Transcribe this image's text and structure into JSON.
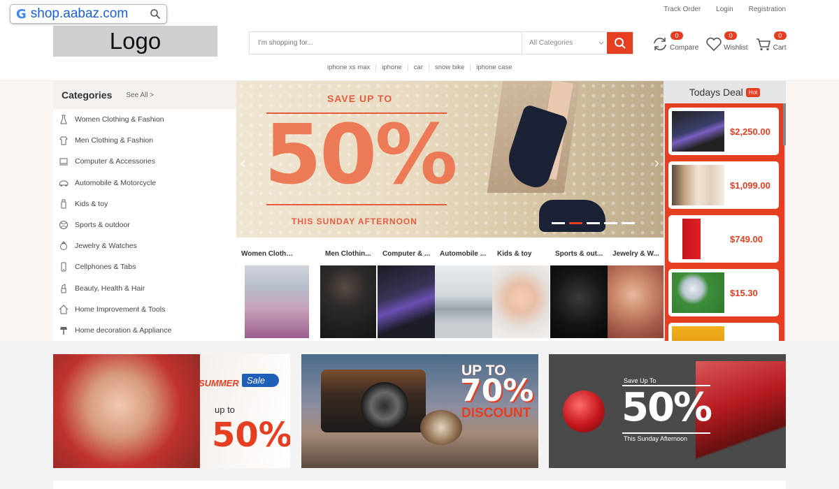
{
  "url_bar": {
    "g": "G",
    "url": "shop.aabaz.com"
  },
  "top_links": [
    "Track Order",
    "Login",
    "Registration"
  ],
  "logo": "Logo",
  "search": {
    "placeholder": "I'm shopping for...",
    "category": "All Categories"
  },
  "quick_searches": [
    "iphone xs max",
    "iphone",
    "car",
    "snow bike",
    "iphone case"
  ],
  "header_icons": [
    {
      "label": "Compare",
      "count": "0",
      "icon": "refresh-icon"
    },
    {
      "label": "Wishlist",
      "count": "0",
      "icon": "heart-icon"
    },
    {
      "label": "Cart",
      "count": "0",
      "icon": "cart-icon"
    }
  ],
  "categories": {
    "title": "Categories",
    "see_all": "See All >",
    "items": [
      "Women Clothing & Fashion",
      "Men Clothing & Fashion",
      "Computer & Accessories",
      "Automobile & Motorcycle",
      "Kids & toy",
      "Sports & outdoor",
      "Jewelry & Watches",
      "Cellphones & Tabs",
      "Beauty, Health & Hair",
      "Home Improvement & Tools",
      "Home decoration & Appliance"
    ]
  },
  "banner": {
    "save_text": "SAVE UP TO",
    "big": "50%",
    "sub": "THIS SUNDAY AFTERNOON",
    "prev": "‹",
    "next": "›",
    "active_slide": 2,
    "slides": 5
  },
  "thumb_categories": [
    "Women Clothing & F...",
    "Men Clothin...",
    "Computer & ...",
    "Automobile ...",
    "Kids & toy",
    "Sports & out...",
    "Jewelry & W..."
  ],
  "deal": {
    "title": "Todays Deal",
    "badge": "Hot",
    "prices": [
      "$2,250.00",
      "$1,099.00",
      "$749.00",
      "$15.30"
    ]
  },
  "promos": {
    "p1": {
      "summer": "SUMMER",
      "sale": "Sale",
      "upto": "up to",
      "pct": "50%"
    },
    "p2": {
      "upto": "UP TO",
      "pct": "70%",
      "word": "DISCOUNT"
    },
    "p3": {
      "save": "Save Up To",
      "pct": "50%",
      "sub": "This Sunday Afternoon"
    }
  },
  "colors": {
    "accent": "#e53e21",
    "banner_orange": "#ec7a56"
  }
}
